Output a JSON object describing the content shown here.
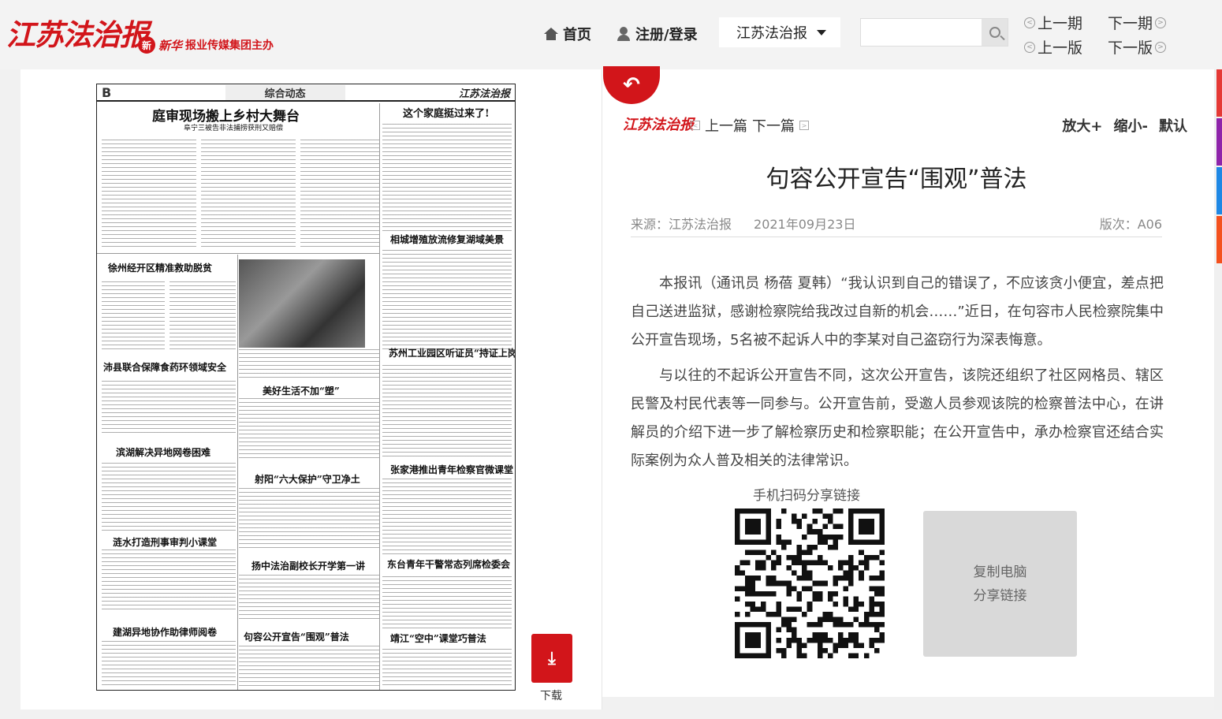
{
  "header": {
    "logo": "江苏法治报",
    "sub_brand": "新华",
    "sub_text": "报业传媒集团主办",
    "nav": {
      "home": "首页",
      "login": "注册/登录"
    },
    "paper_select": "江苏法治报",
    "search_placeholder": "",
    "pager": {
      "prev_issue": "上一期",
      "next_issue": "下一期",
      "prev_page": "上一版",
      "next_page": "下一版"
    }
  },
  "paper": {
    "page_letter": "B",
    "section": "综合动态",
    "masthead": "江苏法治报",
    "headlines": [
      "庭审现场搬上乡村大舞台",
      "阜宁三被告非法捕捞获刑又赔偿",
      "这个家庭挺过来了!",
      "徐州经开区精准救助脱贫",
      "相城增殖放流修复湖域美景",
      "沛县联合保障食药环领域安全",
      "苏州工业园区听证员“持证上岗”",
      "美好生活不加“塑”",
      "滨湖解决异地网卷困难",
      "张家港推出青年检察官微课堂",
      "射阳“六大保护”守卫净土",
      "涟水打造刑事审判小课堂",
      "扬中法治副校长开学第一讲",
      "东台青年干警常态列席检委会",
      "建湖异地协作助律师阅卷",
      "句容公开宣告“围观”普法",
      "靖江“空中”课堂巧普法"
    ],
    "download_label": "下载"
  },
  "article": {
    "logo": "江苏法治报",
    "prev_article": "上一篇",
    "next_article": "下一篇",
    "zoom_in": "放大+",
    "zoom_out": "缩小-",
    "zoom_default": "默认",
    "title": "句容公开宣告“围观”普法",
    "source": "来源：江苏法治报",
    "date": "2021年09月23日",
    "edition": "版次：A06",
    "paragraphs": [
      "本报讯（通讯员 杨蓓 夏韩）“我认识到自己的错误了，不应该贪小便宜，差点把自己送进监狱，感谢检察院给我改过自新的机会……”近日，在句容市人民检察院集中公开宣告现场，5名被不起诉人中的李某对自己盗窃行为深表悔意。",
      "与以往的不起诉公开宣告不同，这次公开宣告，该院还组织了社区网格员、辖区民警及村民代表等一同参与。公开宣告前，受邀人员参观该院的检察普法中心，在讲解员的介绍下进一步了解检察历史和检察职能；在公开宣告中，承办检察官还结合实际案例为众人普及相关的法律常识。"
    ],
    "share_label": "手机扫码分享链接",
    "copy_line1": "复制电脑",
    "copy_line2": "分享链接"
  },
  "colors": {
    "brand_red": "#d2151a"
  }
}
